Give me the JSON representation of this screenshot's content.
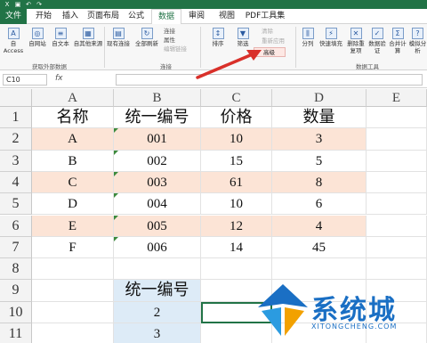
{
  "tabs": [
    "文件",
    "开始",
    "插入",
    "页面布局",
    "公式",
    "数据",
    "审阅",
    "视图",
    "PDF工具集"
  ],
  "active_tab": "数据",
  "ribbon": {
    "external": [
      "自 Access",
      "自网站",
      "自文本",
      "自其他来源",
      "现有连接"
    ],
    "external_group": "获取外部数据",
    "refresh": "全部刷新",
    "conn_small": [
      "连接",
      "属性",
      "编辑链接"
    ],
    "conn_group": "连接",
    "sort": [
      "排序",
      "筛选"
    ],
    "filter_small": [
      "清除",
      "重新应用",
      "高级"
    ],
    "tools": [
      "分列",
      "快速填充",
      "删除重复项",
      "数据验证",
      "合并计算",
      "模拟分析"
    ],
    "tools_group": "数据工具"
  },
  "formula_bar": {
    "name_box": "C10",
    "fx": "fx",
    "content": ""
  },
  "columns": [
    "A",
    "B",
    "C",
    "D",
    "E"
  ],
  "rows": [
    "1",
    "2",
    "3",
    "4",
    "5",
    "6",
    "7",
    "8",
    "9",
    "10",
    "11"
  ],
  "table": {
    "headers": [
      "名称",
      "统一编号",
      "价格",
      "数量"
    ],
    "data": [
      [
        "A",
        "001",
        "10",
        "3"
      ],
      [
        "B",
        "002",
        "15",
        "5"
      ],
      [
        "C",
        "003",
        "61",
        "8"
      ],
      [
        "D",
        "004",
        "10",
        "6"
      ],
      [
        "E",
        "005",
        "12",
        "4"
      ],
      [
        "F",
        "006",
        "14",
        "45"
      ]
    ]
  },
  "criteria": {
    "header": "统一编号",
    "values": [
      "2",
      "3"
    ]
  },
  "watermark": {
    "text": "系统城",
    "sub": "XITONGCHENG.COM"
  },
  "colors": {
    "excel_green": "#217346",
    "pink_fill": "#fce4d6",
    "blue_fill": "#ddebf7",
    "arrow_red": "#d9302a"
  }
}
